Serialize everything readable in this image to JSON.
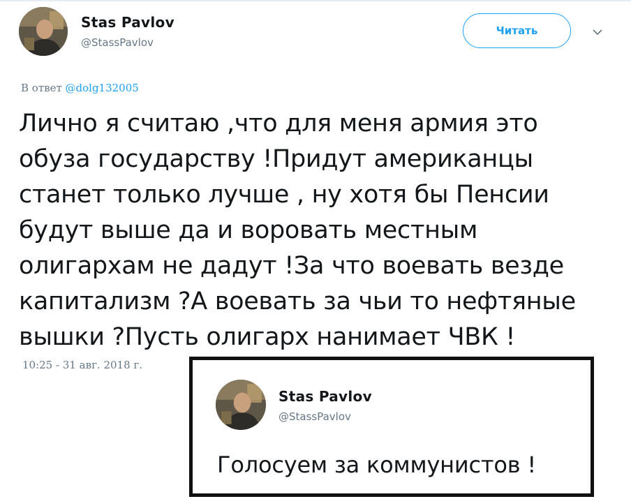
{
  "tweet": {
    "author_name": "Stas Pavlov",
    "author_handle": "@StassPavlov",
    "follow_label": "Читать",
    "reply_prefix": "В ответ ",
    "reply_to": "@dolg132005",
    "text": "Лично я считаю ,что для меня армия это\nобуза государству !Придут американцы\nстанет только лучше , ну хотя бы  Пенсии\nбудут выше да и воровать местным\nолигархам не дадут !За что воевать везде\nкапитализм ?А воевать за чьи то нефтяные\nвышки ?Пусть олигарх нанимает ЧВК !",
    "timestamp": "10:25 - 31 авг. 2018 г."
  },
  "quoted": {
    "author_name": "Stas Pavlov",
    "author_handle": "@StassPavlov",
    "text": "Голосуем за коммунистов !"
  },
  "colors": {
    "accent": "#1da1f2",
    "muted": "#657786",
    "text": "#14171a",
    "quote_border": "#111111"
  },
  "icons": {
    "menu": "chevron-down-icon",
    "avatar": "avatar"
  }
}
